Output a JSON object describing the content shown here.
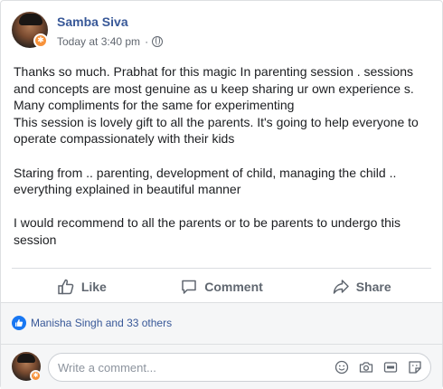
{
  "post": {
    "author": "Samba Siva",
    "timestamp": "Today at 3:40 pm",
    "separator": "·",
    "audience_icon": "globe-icon",
    "avatar_badge": "✱",
    "paragraphs": [
      [
        "Thanks so much. Prabhat for this magic In parenting session . sessions and concepts are most genuine as u keep sharing ur own experience s.",
        "Many compliments for the same for experimenting",
        "This session is lovely gift to all the parents. It's going to help everyone to operate compassionately with their kids"
      ],
      [
        "Staring from .. parenting, development of child, managing the child .. everything explained in beautiful manner"
      ],
      [
        "I would recommend to all the parents or to be parents to undergo this session"
      ]
    ]
  },
  "actions": {
    "like": "Like",
    "comment": "Comment",
    "share": "Share"
  },
  "reactions": {
    "summary": "Manisha Singh and 33 others"
  },
  "comment_box": {
    "placeholder": "Write a comment..."
  },
  "colors": {
    "link": "#385898",
    "like_blue": "#1877f2",
    "muted": "#606770",
    "badge": "#f7923b"
  }
}
